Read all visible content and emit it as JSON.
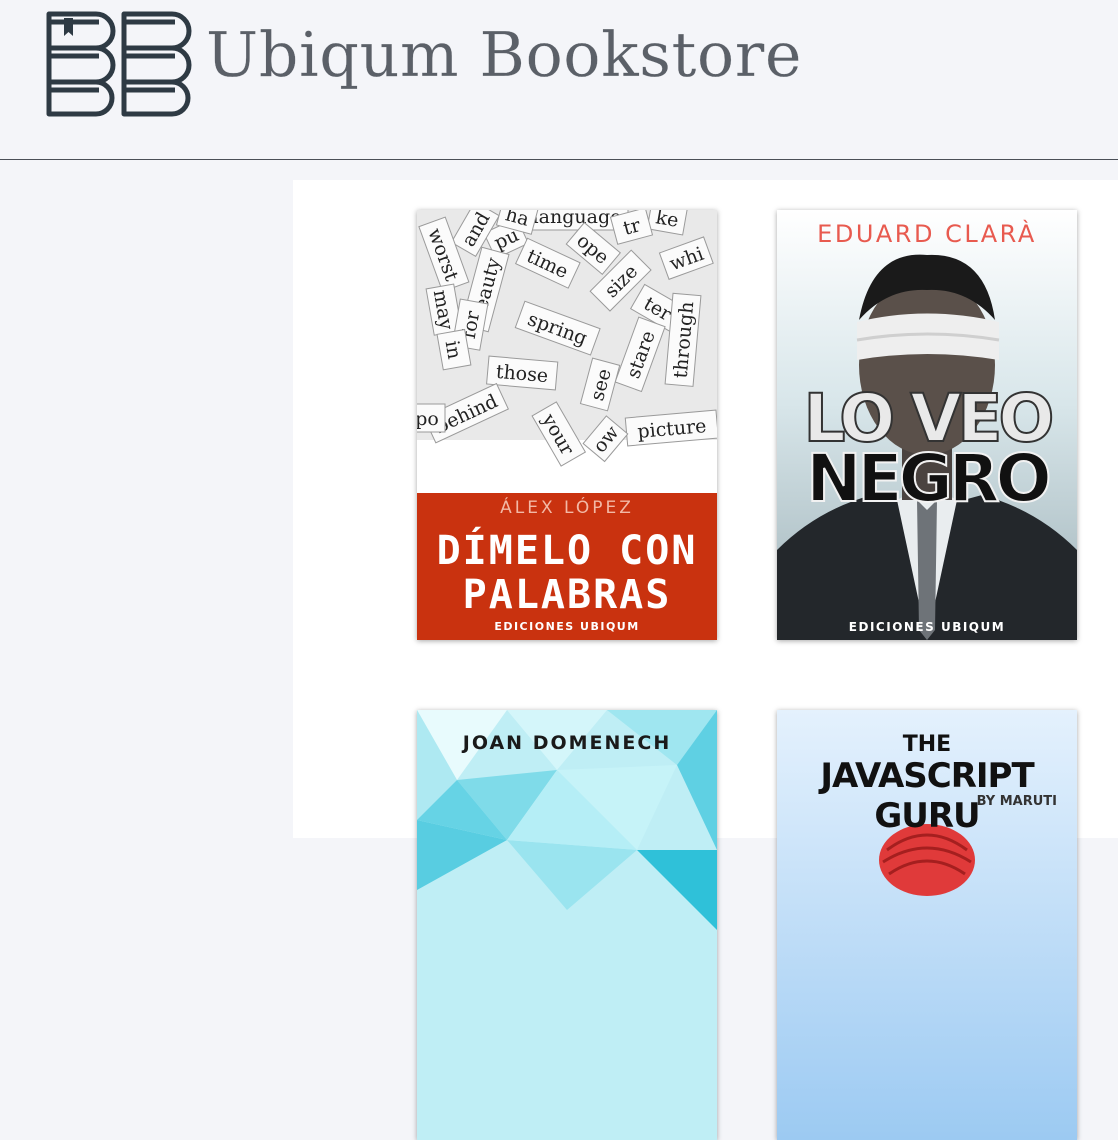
{
  "header": {
    "title": "Ubiqum Bookstore",
    "logo_icon": "books-stack-logo-icon"
  },
  "colors": {
    "background": "#f4f5f9",
    "panel": "#ffffff",
    "title": "#5b6068",
    "logo": "#2e3a44",
    "red": "#c9320f",
    "author_red": "#e85a4f"
  },
  "books": [
    {
      "author": "ÁLEX LÓPEZ",
      "title_line1": "DÍMELO CON",
      "title_line2": "PALABRAS",
      "publisher": "EDICIONES UBIQUM",
      "words": [
        "language",
        "pu",
        "and",
        "ke",
        "worst",
        "time",
        "ope",
        "whi",
        "beauty",
        "size",
        "may",
        "for",
        "spring",
        "ter",
        "through",
        "in",
        "those",
        "stare",
        "see",
        "behind",
        "your",
        "picture",
        "ow",
        "po",
        "ha",
        "tr"
      ]
    },
    {
      "author": "EDUARD CLARÀ",
      "title_line1": "LO VEO",
      "title_line2": "NEGRO",
      "publisher": "EDICIONES UBIQUM"
    },
    {
      "author": "JOAN DOMENECH"
    },
    {
      "title_line1": "THE",
      "title_line2": "JAVASCRIPT GURU",
      "byline": "BY MARUTI"
    }
  ]
}
